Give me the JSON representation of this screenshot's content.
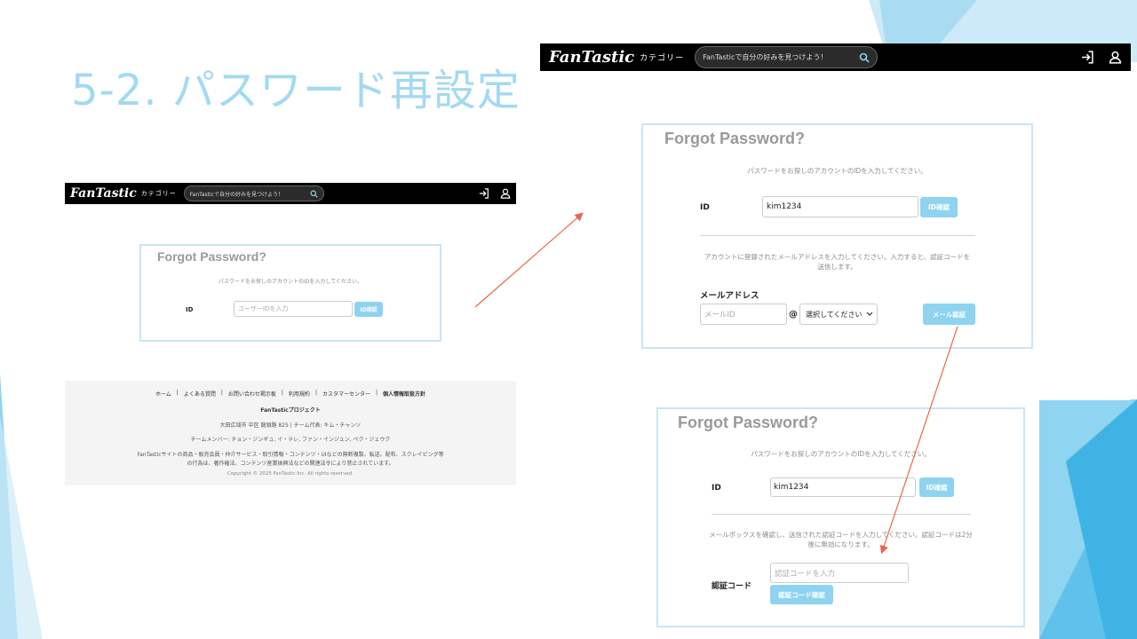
{
  "slide": {
    "title": "5-2. パスワード再設定"
  },
  "navbar": {
    "logo": "FanTastic",
    "category_label": "カテゴリー",
    "search_placeholder": "FanTasticで自分の好みを見つけよう！",
    "icons": [
      "search-icon",
      "login-icon",
      "user-icon"
    ]
  },
  "screen_initial": {
    "title": "Forgot Password?",
    "instruction": "パスワードをお探しのアカウントのIDを入力してください。",
    "id_label": "ID",
    "id_placeholder": "ユーザーIDを入力",
    "id_check_button": "ID確認"
  },
  "screen_email": {
    "title": "Forgot Password?",
    "instruction": "パスワードをお探しのアカウントのIDを入力してください。",
    "id_label": "ID",
    "id_value": "kim1234",
    "id_check_button": "ID確認",
    "email_instruction_line1": "アカウントに登録されたメールアドレスを入力してください。入力すると、認証コードを",
    "email_instruction_line2": "送信します。",
    "email_label": "メールアドレス",
    "email_placeholder": "メールID",
    "at_sign": "@",
    "domain_select": "選択してください",
    "email_verify_button": "メール認証"
  },
  "screen_code": {
    "title": "Forgot Password?",
    "instruction": "パスワードをお探しのアカウントのIDを入力してください。",
    "id_label": "ID",
    "id_value": "kim1234",
    "id_check_button": "ID確認",
    "code_instruction_line1": "メールボックスを確認し、送信された認証コードを入力してください。認証コードは2分",
    "code_instruction_line2": "後に無効になります。",
    "code_label": "認証コード",
    "code_placeholder": "認証コードを入力",
    "code_verify_button": "認証コード確認"
  },
  "footer": {
    "links": [
      "ホーム",
      "よくある質問",
      "お問い合わせ掲示板",
      "利用規約",
      "カスタマーセンター",
      "個人情報取扱方針"
    ],
    "separator": "|",
    "project": "FanTasticプロジェクト",
    "address": "大田広域市 中区 龍頭路 825 | チーム代表: キム・チャンソ",
    "members": "チームメンバー: チョン・ジンギュ, イ・テレ, ファン・インジュン, ペク・ジェウク",
    "notice_line1": "FanTasticサイトの商品・販売会員・仲介サービス・取引情報・コンテンツ・UIなどの無断複製、転送、配布、スクレイピング等",
    "notice_line2": "の行為は、著作権法、コンテンツ産業振興法などの関連法令により禁止されています。",
    "copyright": "Copyright © 2025 FanTastic Inc. All rights reserved."
  },
  "colors": {
    "accent": "#8ed3f0",
    "panel_border": "#c7e6f5",
    "title": "#a3d9f2",
    "arrow": "#e8664c",
    "navbar": "#000000"
  }
}
